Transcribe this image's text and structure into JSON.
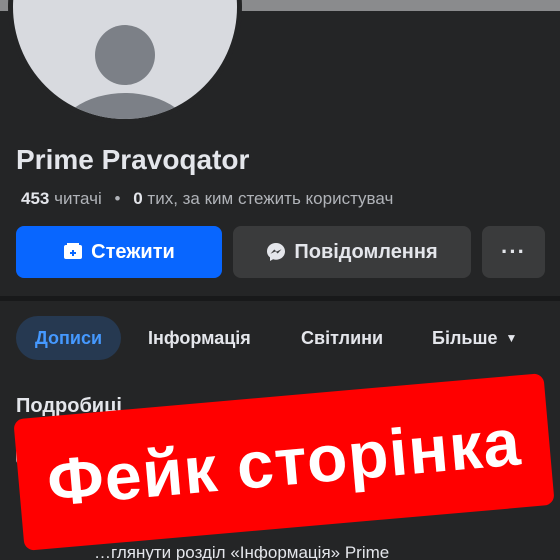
{
  "profile": {
    "name": "Prime Pravoqator",
    "followers_count": "453",
    "followers_label": "читачі",
    "following_count": "0",
    "following_label": "тих, за ким стежить користувач"
  },
  "actions": {
    "follow_label": "Стежити",
    "message_label": "Повідомлення",
    "more_label": "···"
  },
  "tabs": [
    {
      "label": "Дописи",
      "active": true
    },
    {
      "label": "Інформація",
      "active": false
    },
    {
      "label": "Світлини",
      "active": false
    },
    {
      "label": "Більше",
      "active": false
    }
  ],
  "details": {
    "title": "Подробиці",
    "row1_text": "С",
    "row3_text": "…глянути розділ «Інформація» Prime"
  },
  "overlay": {
    "stamp_text": "Фейк сторінка"
  },
  "colors": {
    "background": "#242526",
    "accent": "#0866ff",
    "stamp": "#ff0000"
  },
  "icons": [
    "add-friend-icon",
    "messenger-icon",
    "more-icon",
    "chevron-down-icon"
  ]
}
